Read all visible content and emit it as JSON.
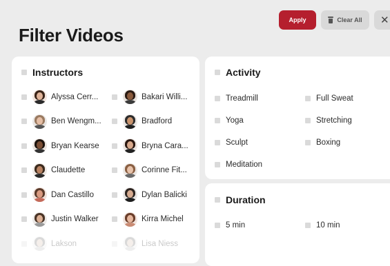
{
  "header": {
    "title": "Filter Videos",
    "apply_label": "Apply",
    "clear_label": "Clear All",
    "close_glyph": "✕"
  },
  "instructors": {
    "heading": "Instructors",
    "items": [
      {
        "name": "Alyssa Cerr...",
        "hair": "#3a2418",
        "skin": "#e0b49a",
        "bg": "#f2e6df",
        "shirt": "#2b2b2b"
      },
      {
        "name": "Bakari Willi...",
        "hair": "#2a1a12",
        "skin": "#8a5a3c",
        "bg": "#e8e2dd",
        "shirt": "#3b3b3b"
      },
      {
        "name": "Ben Wengm...",
        "hair": "#9a7a60",
        "skin": "#e6bfa6",
        "bg": "#e9e6e4",
        "shirt": "#555555"
      },
      {
        "name": "Bradford",
        "hair": "#2c2c2c",
        "skin": "#c9946e",
        "bg": "#ece8e6",
        "shirt": "#1f1f1f"
      },
      {
        "name": "Bryan Kearse",
        "hair": "#1c120c",
        "skin": "#7b4e34",
        "bg": "#eae3de",
        "shirt": "#333333"
      },
      {
        "name": "Bryna Cara...",
        "hair": "#2a1710",
        "skin": "#d8a98c",
        "bg": "#ebe5e1",
        "shirt": "#222222"
      },
      {
        "name": "Claudette",
        "hair": "#3b2a1d",
        "skin": "#b98363",
        "bg": "#efe9e5",
        "shirt": "#2a2a2a"
      },
      {
        "name": "Corinne Fit...",
        "hair": "#8a5f42",
        "skin": "#e8c3ab",
        "bg": "#ede9e6",
        "shirt": "#6a6a6a"
      },
      {
        "name": "Dan Castillo",
        "hair": "#5a3a2a",
        "skin": "#d99a80",
        "bg": "#f0e1da",
        "shirt": "#c46a5a"
      },
      {
        "name": "Dylan Balicki",
        "hair": "#2d2420",
        "skin": "#d6ab90",
        "bg": "#e8e5e3",
        "shirt": "#1e1e1e"
      },
      {
        "name": "Justin Walker",
        "hair": "#4a3426",
        "skin": "#dcb095",
        "bg": "#ece9e7",
        "shirt": "#9a9a9a"
      },
      {
        "name": "Kirra Michel",
        "hair": "#6a3e2a",
        "skin": "#e6b79e",
        "bg": "#f1e4de",
        "shirt": "#c98b74"
      },
      {
        "name": "Lakson",
        "hair": "#6b6b6b",
        "skin": "#d8c2b4",
        "bg": "#eeeeee",
        "shirt": "#bdbdbd"
      },
      {
        "name": "Lisa Niess",
        "hair": "#6b6b6b",
        "skin": "#d8c2b4",
        "bg": "#eeeeee",
        "shirt": "#bdbdbd"
      }
    ]
  },
  "activity": {
    "heading": "Activity",
    "items": [
      "Treadmill",
      "Full Sweat",
      "Yoga",
      "Stretching",
      "Sculpt",
      "Boxing",
      "Meditation"
    ]
  },
  "duration": {
    "heading": "Duration",
    "items": [
      "5 min",
      "10 min"
    ]
  },
  "colors": {
    "accent": "#b51f2e",
    "checkbox": "#dadada",
    "background": "#ececec",
    "card": "#ffffff"
  },
  "icons": {
    "clear": "trash-icon",
    "close": "close-icon"
  }
}
